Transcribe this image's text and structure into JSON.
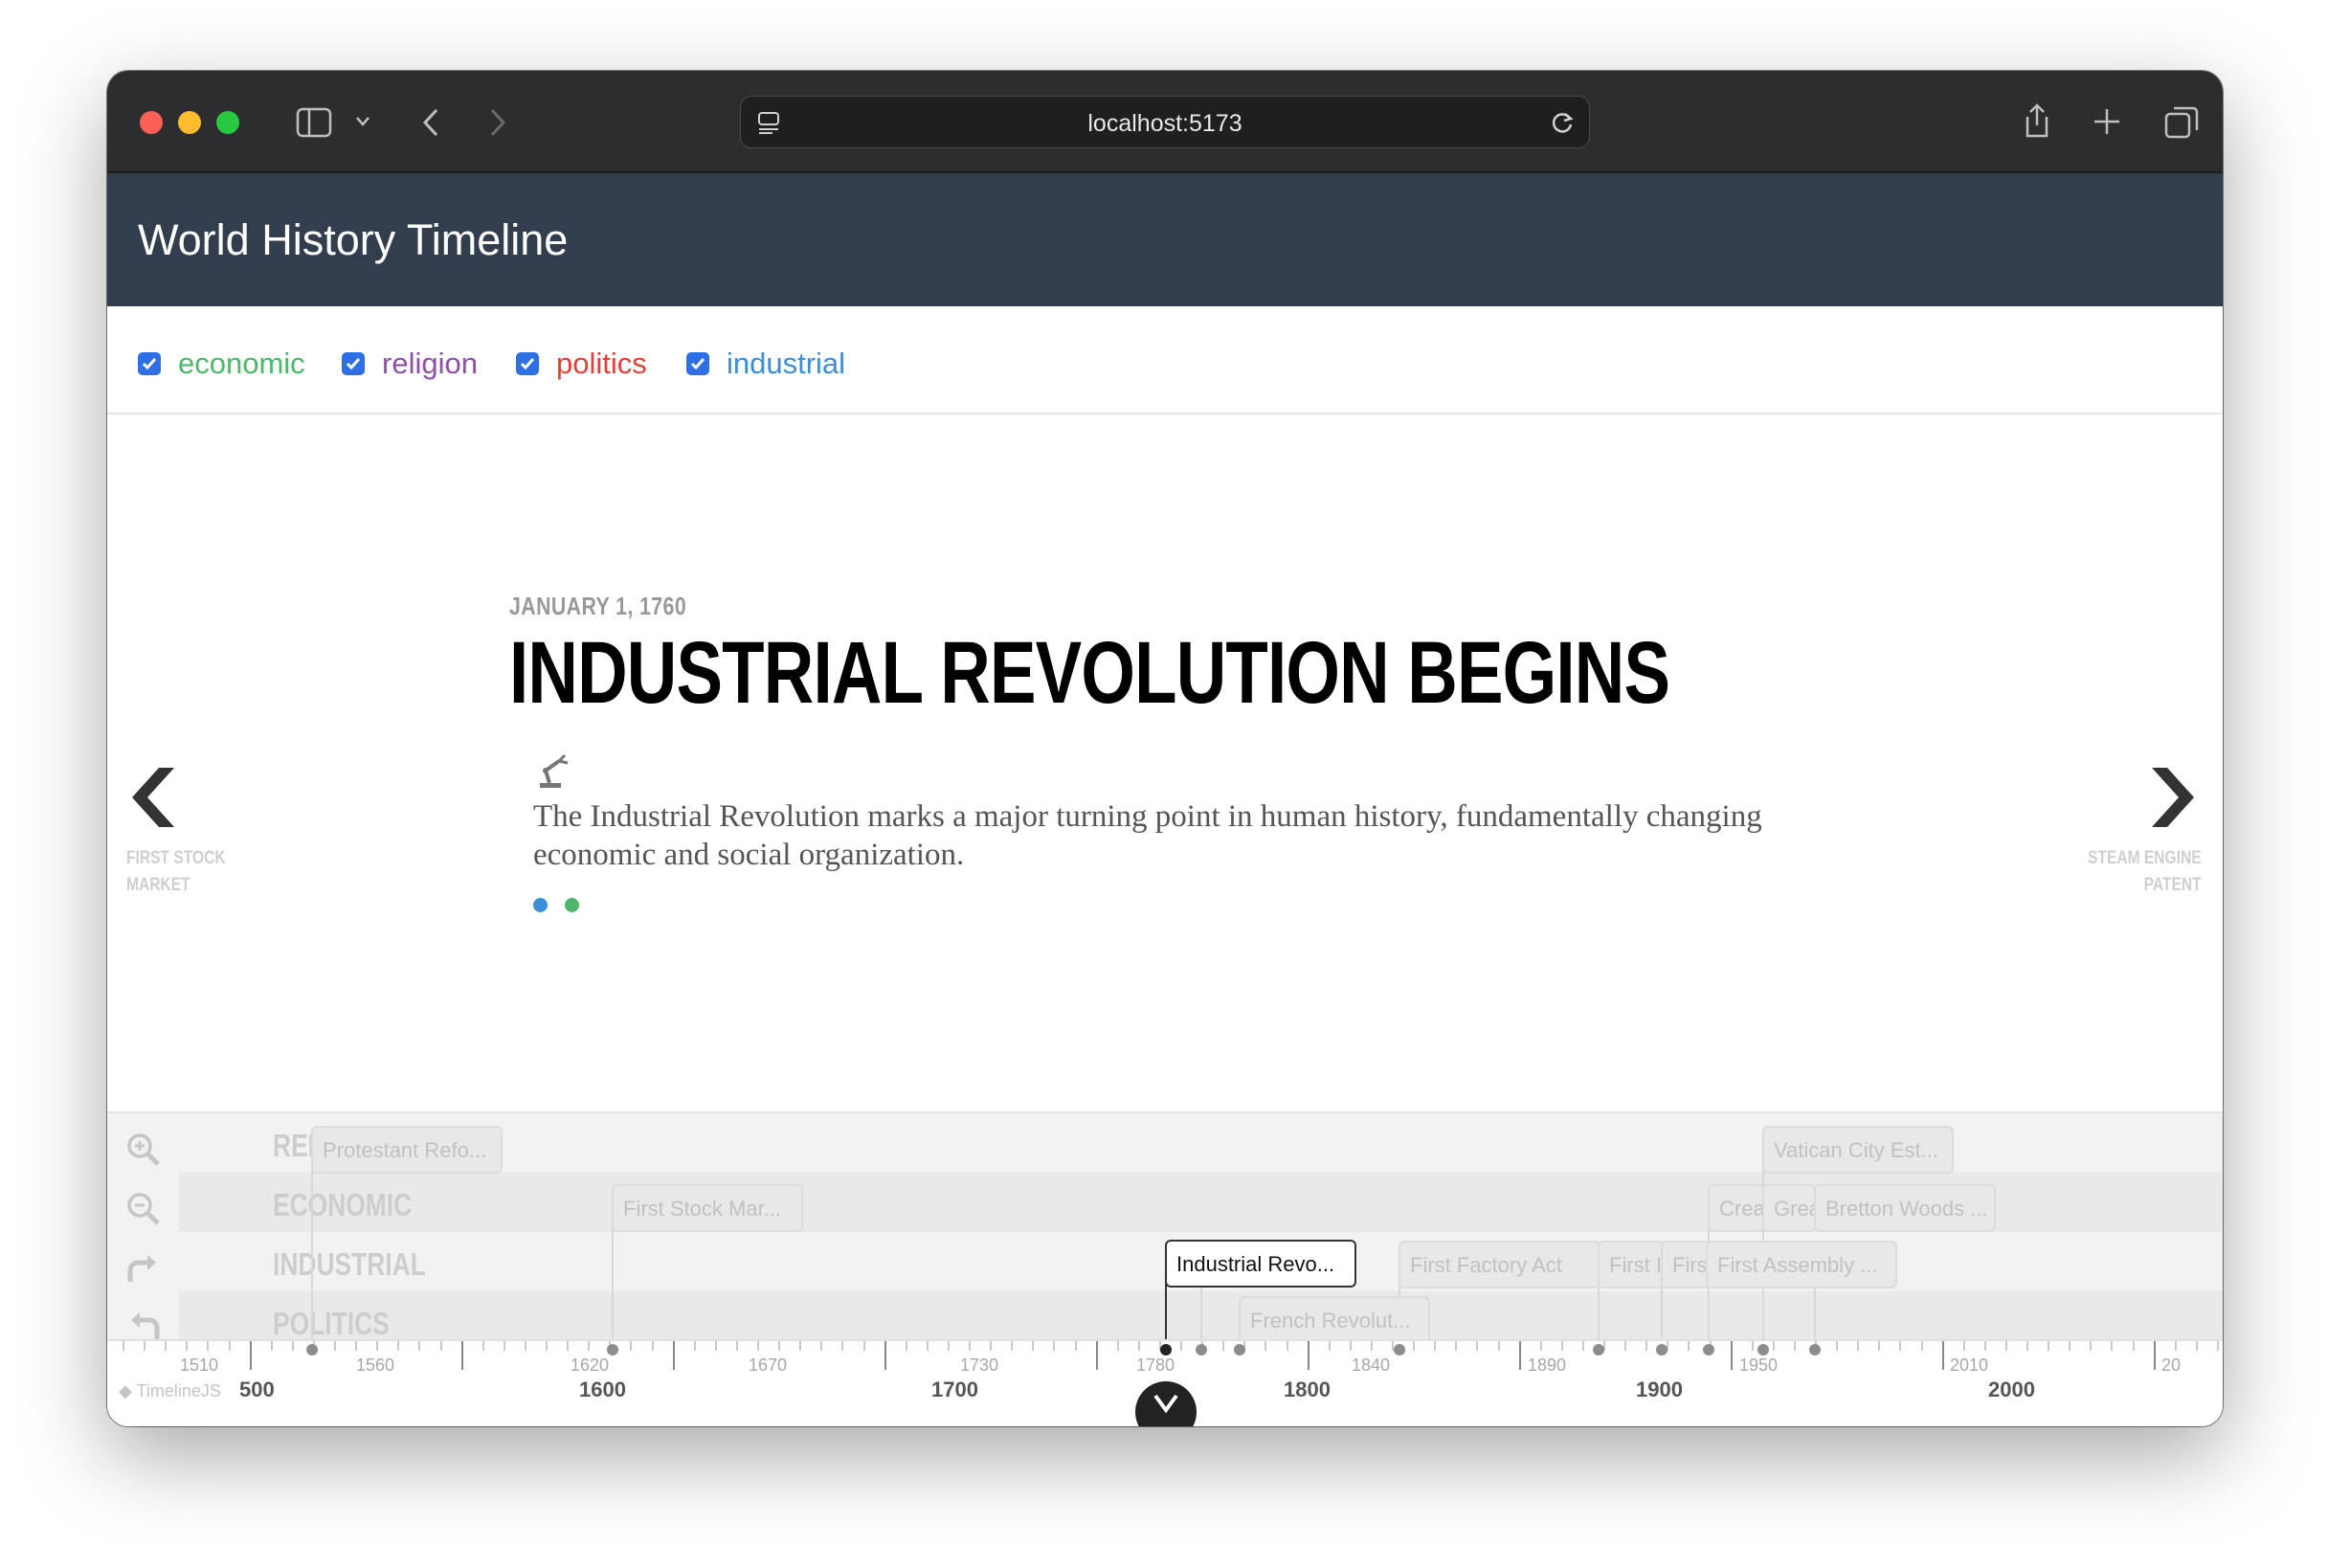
{
  "browser": {
    "url": "localhost:5173"
  },
  "app": {
    "title": "World History Timeline"
  },
  "filters": [
    {
      "label": "economic",
      "checked": true,
      "color": "#4cb86b"
    },
    {
      "label": "religion",
      "checked": true,
      "color": "#8e4fa8"
    },
    {
      "label": "politics",
      "checked": true,
      "color": "#e0413a"
    },
    {
      "label": "industrial",
      "checked": true,
      "color": "#3a8fd8"
    }
  ],
  "slide": {
    "date": "JANUARY 1, 1760",
    "headline": "INDUSTRIAL REVOLUTION BEGINS",
    "icon": "robot-arm-icon",
    "description": "The Industrial Revolution marks a major turning point in human history, fundamentally changing economic and social organization.",
    "tag_colors": [
      "#3a8fd8",
      "#4cb86b"
    ],
    "prev": {
      "line1": "FIRST STOCK",
      "line2": "MARKET"
    },
    "next": {
      "line1": "STEAM ENGINE",
      "line2": "PATENT"
    }
  },
  "timenav": {
    "groups": [
      {
        "label": "RELIGION",
        "short": "RELI"
      },
      {
        "label": "ECONOMIC"
      },
      {
        "label": "INDUSTRIAL"
      },
      {
        "label": "POLITICS"
      }
    ],
    "events": [
      {
        "group": "religion",
        "label": "Protestant Refo..."
      },
      {
        "group": "religion",
        "label": "Vatican City Est..."
      },
      {
        "group": "economic",
        "label": "First Stock Mar..."
      },
      {
        "group": "economic",
        "label": "Crea"
      },
      {
        "group": "economic",
        "label": "Grea"
      },
      {
        "group": "economic",
        "label": "Bretton Woods ..."
      },
      {
        "group": "industrial",
        "label": "Industrial Revo...",
        "active": true
      },
      {
        "group": "industrial",
        "label": "..."
      },
      {
        "group": "industrial",
        "label": "First Factory Act"
      },
      {
        "group": "industrial",
        "label": "First I"
      },
      {
        "group": "industrial",
        "label": "Firs"
      },
      {
        "group": "industrial",
        "label": "First Assembly ..."
      },
      {
        "group": "politics",
        "label": "French Revolut..."
      }
    ],
    "minor_ticks": [
      "1510",
      "1560",
      "1620",
      "1670",
      "1730",
      "1780",
      "1840",
      "1890",
      "1950",
      "2010",
      "20"
    ],
    "major_ticks": [
      "500",
      "1600",
      "1700",
      "1800",
      "1900",
      "2000"
    ],
    "credit": "TimelineJS"
  }
}
